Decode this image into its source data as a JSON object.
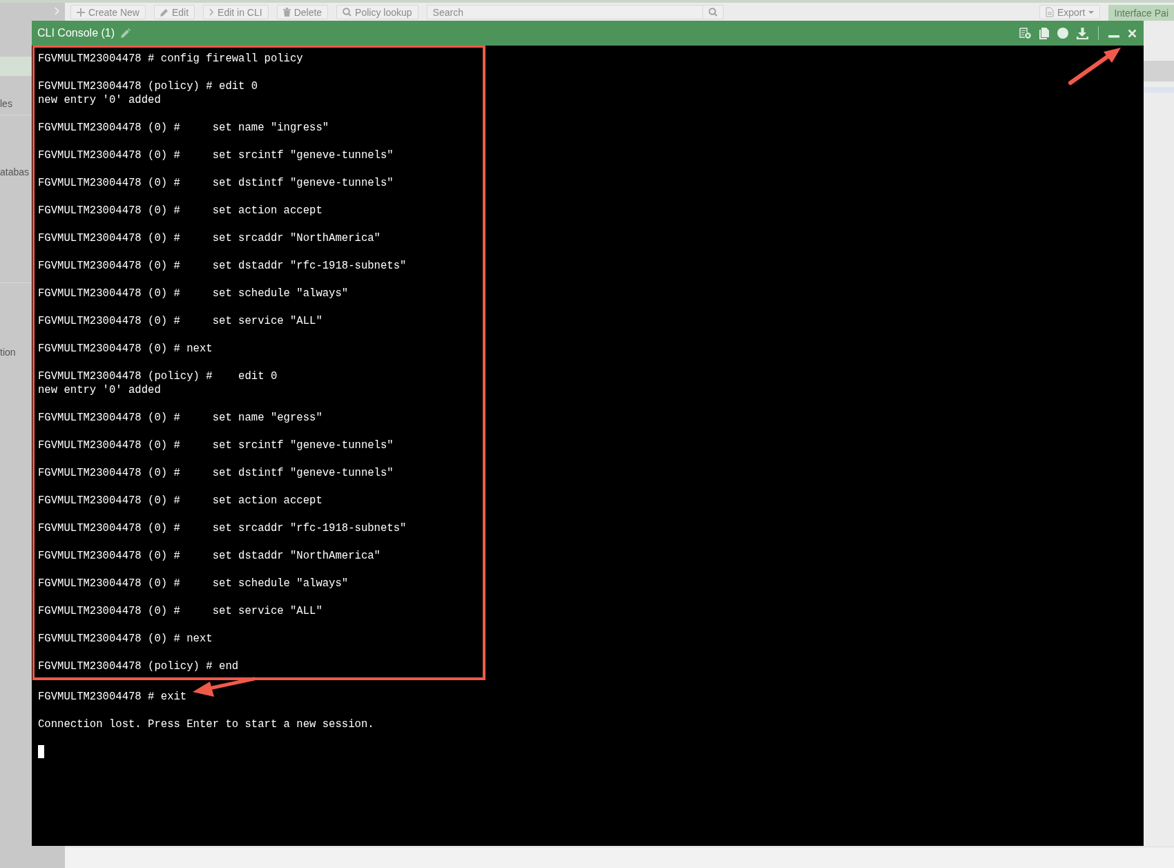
{
  "background": {
    "toolbar": [
      {
        "kind": "button",
        "label": "Create New"
      },
      {
        "kind": "button",
        "label": "Edit"
      },
      {
        "kind": "button",
        "label": "Edit in CLI"
      },
      {
        "kind": "button",
        "label": "Delete"
      },
      {
        "kind": "button",
        "label": "Policy lookup"
      },
      {
        "kind": "search",
        "placeholder": "Search"
      },
      {
        "kind": "spacer"
      },
      {
        "kind": "dropdown",
        "label": "Export"
      },
      {
        "kind": "tab",
        "label": "Interface Pai"
      }
    ],
    "sidebar_items": [
      {
        "label": "les"
      },
      {
        "label": "atabas"
      },
      {
        "label": "tion"
      }
    ]
  },
  "console": {
    "title": "CLI Console (1)",
    "highlighted_entries": [
      {
        "lines": [
          "FGVMULTM23004478 # config firewall policy"
        ]
      },
      {
        "lines": [
          "FGVMULTM23004478 (policy) # edit 0",
          "new entry '0' added"
        ]
      },
      {
        "lines": [
          "FGVMULTM23004478 (0) #     set name \"ingress\""
        ]
      },
      {
        "lines": [
          "FGVMULTM23004478 (0) #     set srcintf \"geneve-tunnels\""
        ]
      },
      {
        "lines": [
          "FGVMULTM23004478 (0) #     set dstintf \"geneve-tunnels\""
        ]
      },
      {
        "lines": [
          "FGVMULTM23004478 (0) #     set action accept"
        ]
      },
      {
        "lines": [
          "FGVMULTM23004478 (0) #     set srcaddr \"NorthAmerica\""
        ]
      },
      {
        "lines": [
          "FGVMULTM23004478 (0) #     set dstaddr \"rfc-1918-subnets\""
        ]
      },
      {
        "lines": [
          "FGVMULTM23004478 (0) #     set schedule \"always\""
        ]
      },
      {
        "lines": [
          "FGVMULTM23004478 (0) #     set service \"ALL\""
        ]
      },
      {
        "lines": [
          "FGVMULTM23004478 (0) # next"
        ]
      },
      {
        "lines": [
          "FGVMULTM23004478 (policy) #    edit 0",
          "new entry '0' added"
        ]
      },
      {
        "lines": [
          "FGVMULTM23004478 (0) #     set name \"egress\""
        ]
      },
      {
        "lines": [
          "FGVMULTM23004478 (0) #     set srcintf \"geneve-tunnels\""
        ]
      },
      {
        "lines": [
          "FGVMULTM23004478 (0) #     set dstintf \"geneve-tunnels\""
        ]
      },
      {
        "lines": [
          "FGVMULTM23004478 (0) #     set action accept"
        ]
      },
      {
        "lines": [
          "FGVMULTM23004478 (0) #     set srcaddr \"rfc-1918-subnets\""
        ]
      },
      {
        "lines": [
          "FGVMULTM23004478 (0) #     set dstaddr \"NorthAmerica\""
        ]
      },
      {
        "lines": [
          "FGVMULTM23004478 (0) #     set schedule \"always\""
        ]
      },
      {
        "lines": [
          "FGVMULTM23004478 (0) #     set service \"ALL\""
        ]
      },
      {
        "lines": [
          "FGVMULTM23004478 (0) # next"
        ]
      },
      {
        "lines": [
          "FGVMULTM23004478 (policy) # end"
        ]
      }
    ],
    "entries": [
      {
        "lines": [
          "FGVMULTM23004478 # exit"
        ]
      },
      {
        "lines": [
          "Connection lost. Press Enter to start a new session."
        ]
      }
    ],
    "cursor": true
  }
}
